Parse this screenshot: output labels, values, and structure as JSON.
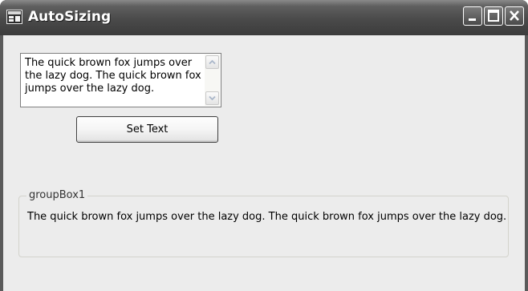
{
  "window": {
    "title": "AutoSizing",
    "controls": {
      "minimize_icon": "minimize-icon",
      "maximize_icon": "maximize-icon",
      "close_icon": "close-icon"
    }
  },
  "textbox": {
    "value": "The quick brown fox jumps over the lazy dog. The quick brown fox jumps over the lazy dog.",
    "scroll_up_icon": "chevron-up-icon",
    "scroll_down_icon": "chevron-down-icon"
  },
  "set_text_button": {
    "label": "Set Text"
  },
  "group_box": {
    "title": "groupBox1",
    "label": "The quick brown fox jumps over the lazy dog. The quick brown fox jumps over the lazy dog."
  },
  "colors": {
    "titlebar": "#4a4a4a",
    "client_background": "#ececec",
    "window_frame": "#5a5a5a"
  }
}
